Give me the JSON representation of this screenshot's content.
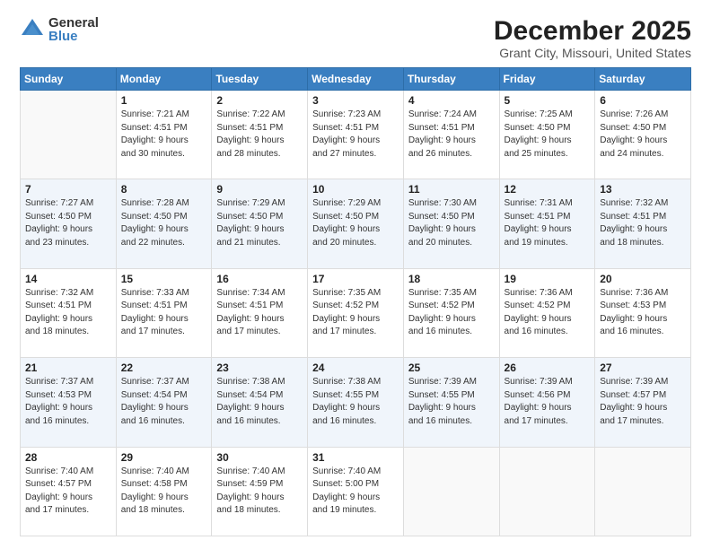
{
  "logo": {
    "general": "General",
    "blue": "Blue"
  },
  "header": {
    "month_title": "December 2025",
    "location": "Grant City, Missouri, United States"
  },
  "days_of_week": [
    "Sunday",
    "Monday",
    "Tuesday",
    "Wednesday",
    "Thursday",
    "Friday",
    "Saturday"
  ],
  "weeks": [
    [
      {
        "day": "",
        "info": ""
      },
      {
        "day": "1",
        "info": "Sunrise: 7:21 AM\nSunset: 4:51 PM\nDaylight: 9 hours\nand 30 minutes."
      },
      {
        "day": "2",
        "info": "Sunrise: 7:22 AM\nSunset: 4:51 PM\nDaylight: 9 hours\nand 28 minutes."
      },
      {
        "day": "3",
        "info": "Sunrise: 7:23 AM\nSunset: 4:51 PM\nDaylight: 9 hours\nand 27 minutes."
      },
      {
        "day": "4",
        "info": "Sunrise: 7:24 AM\nSunset: 4:51 PM\nDaylight: 9 hours\nand 26 minutes."
      },
      {
        "day": "5",
        "info": "Sunrise: 7:25 AM\nSunset: 4:50 PM\nDaylight: 9 hours\nand 25 minutes."
      },
      {
        "day": "6",
        "info": "Sunrise: 7:26 AM\nSunset: 4:50 PM\nDaylight: 9 hours\nand 24 minutes."
      }
    ],
    [
      {
        "day": "7",
        "info": "Sunrise: 7:27 AM\nSunset: 4:50 PM\nDaylight: 9 hours\nand 23 minutes."
      },
      {
        "day": "8",
        "info": "Sunrise: 7:28 AM\nSunset: 4:50 PM\nDaylight: 9 hours\nand 22 minutes."
      },
      {
        "day": "9",
        "info": "Sunrise: 7:29 AM\nSunset: 4:50 PM\nDaylight: 9 hours\nand 21 minutes."
      },
      {
        "day": "10",
        "info": "Sunrise: 7:29 AM\nSunset: 4:50 PM\nDaylight: 9 hours\nand 20 minutes."
      },
      {
        "day": "11",
        "info": "Sunrise: 7:30 AM\nSunset: 4:50 PM\nDaylight: 9 hours\nand 20 minutes."
      },
      {
        "day": "12",
        "info": "Sunrise: 7:31 AM\nSunset: 4:51 PM\nDaylight: 9 hours\nand 19 minutes."
      },
      {
        "day": "13",
        "info": "Sunrise: 7:32 AM\nSunset: 4:51 PM\nDaylight: 9 hours\nand 18 minutes."
      }
    ],
    [
      {
        "day": "14",
        "info": "Sunrise: 7:32 AM\nSunset: 4:51 PM\nDaylight: 9 hours\nand 18 minutes."
      },
      {
        "day": "15",
        "info": "Sunrise: 7:33 AM\nSunset: 4:51 PM\nDaylight: 9 hours\nand 17 minutes."
      },
      {
        "day": "16",
        "info": "Sunrise: 7:34 AM\nSunset: 4:51 PM\nDaylight: 9 hours\nand 17 minutes."
      },
      {
        "day": "17",
        "info": "Sunrise: 7:35 AM\nSunset: 4:52 PM\nDaylight: 9 hours\nand 17 minutes."
      },
      {
        "day": "18",
        "info": "Sunrise: 7:35 AM\nSunset: 4:52 PM\nDaylight: 9 hours\nand 16 minutes."
      },
      {
        "day": "19",
        "info": "Sunrise: 7:36 AM\nSunset: 4:52 PM\nDaylight: 9 hours\nand 16 minutes."
      },
      {
        "day": "20",
        "info": "Sunrise: 7:36 AM\nSunset: 4:53 PM\nDaylight: 9 hours\nand 16 minutes."
      }
    ],
    [
      {
        "day": "21",
        "info": "Sunrise: 7:37 AM\nSunset: 4:53 PM\nDaylight: 9 hours\nand 16 minutes."
      },
      {
        "day": "22",
        "info": "Sunrise: 7:37 AM\nSunset: 4:54 PM\nDaylight: 9 hours\nand 16 minutes."
      },
      {
        "day": "23",
        "info": "Sunrise: 7:38 AM\nSunset: 4:54 PM\nDaylight: 9 hours\nand 16 minutes."
      },
      {
        "day": "24",
        "info": "Sunrise: 7:38 AM\nSunset: 4:55 PM\nDaylight: 9 hours\nand 16 minutes."
      },
      {
        "day": "25",
        "info": "Sunrise: 7:39 AM\nSunset: 4:55 PM\nDaylight: 9 hours\nand 16 minutes."
      },
      {
        "day": "26",
        "info": "Sunrise: 7:39 AM\nSunset: 4:56 PM\nDaylight: 9 hours\nand 17 minutes."
      },
      {
        "day": "27",
        "info": "Sunrise: 7:39 AM\nSunset: 4:57 PM\nDaylight: 9 hours\nand 17 minutes."
      }
    ],
    [
      {
        "day": "28",
        "info": "Sunrise: 7:40 AM\nSunset: 4:57 PM\nDaylight: 9 hours\nand 17 minutes."
      },
      {
        "day": "29",
        "info": "Sunrise: 7:40 AM\nSunset: 4:58 PM\nDaylight: 9 hours\nand 18 minutes."
      },
      {
        "day": "30",
        "info": "Sunrise: 7:40 AM\nSunset: 4:59 PM\nDaylight: 9 hours\nand 18 minutes."
      },
      {
        "day": "31",
        "info": "Sunrise: 7:40 AM\nSunset: 5:00 PM\nDaylight: 9 hours\nand 19 minutes."
      },
      {
        "day": "",
        "info": ""
      },
      {
        "day": "",
        "info": ""
      },
      {
        "day": "",
        "info": ""
      }
    ]
  ]
}
